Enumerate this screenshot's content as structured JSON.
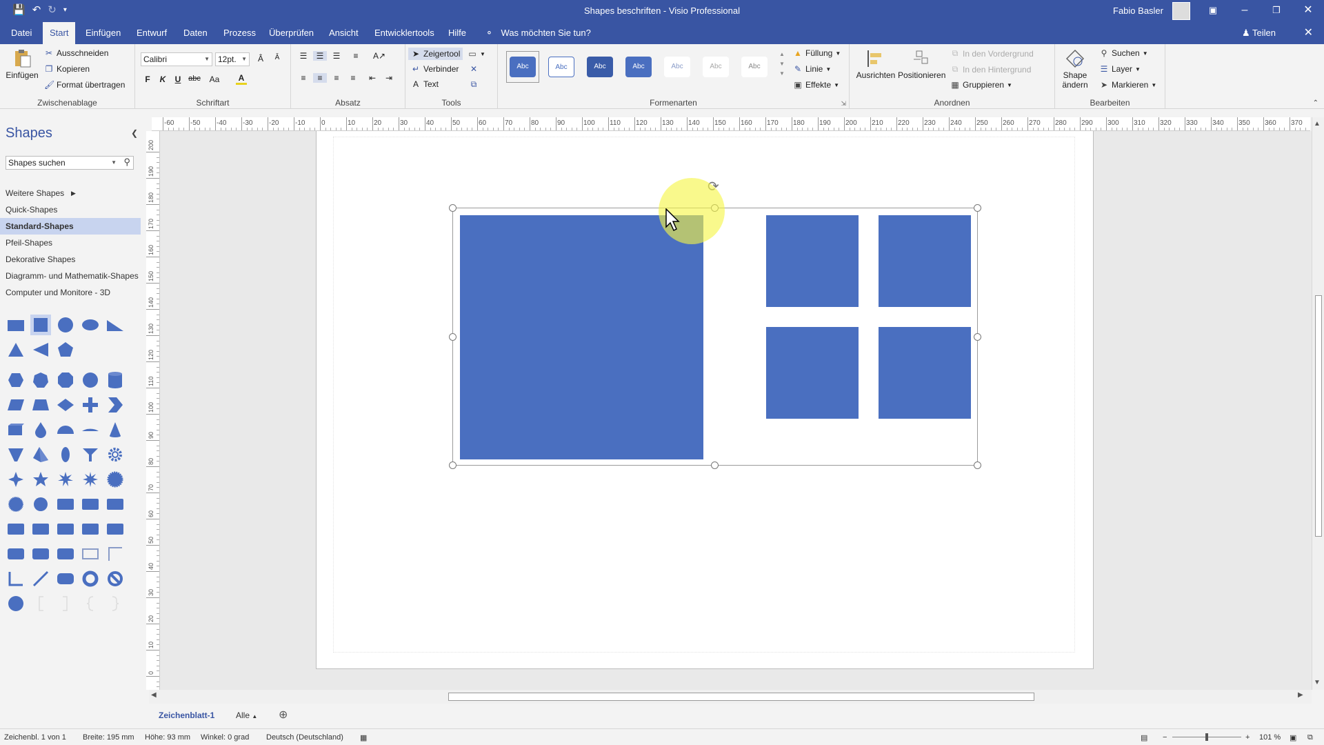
{
  "titlebar": {
    "title": "Shapes beschriften - Visio Professional",
    "user": "Fabio Basler",
    "icons": [
      "save-icon",
      "undo-icon",
      "redo-icon",
      "customize-qat-icon"
    ]
  },
  "tabs": {
    "items": [
      "Datei",
      "Start",
      "Einfügen",
      "Entwurf",
      "Daten",
      "Prozess",
      "Überprüfen",
      "Ansicht",
      "Entwicklertools",
      "Hilfe"
    ],
    "active": "Start",
    "tell_me": "Was möchten Sie tun?",
    "share": "Teilen"
  },
  "ribbon": {
    "clipboard": {
      "label": "Zwischenablage",
      "paste": "Einfügen",
      "cut": "Ausschneiden",
      "copy": "Kopieren",
      "format_painter": "Format übertragen"
    },
    "font": {
      "label": "Schriftart",
      "font_name": "Calibri",
      "font_size": "12pt.",
      "bold": "F",
      "italic": "K",
      "underline": "U",
      "strike": "abc",
      "case": "Aa"
    },
    "paragraph": {
      "label": "Absatz"
    },
    "tools": {
      "label": "Tools",
      "pointer": "Zeigertool",
      "connector": "Verbinder",
      "text": "Text"
    },
    "shape_styles": {
      "label": "Formenarten",
      "sample": "Abc",
      "fill": "Füllung",
      "line": "Linie",
      "effects": "Effekte"
    },
    "arrange": {
      "label": "Anordnen",
      "align": "Ausrichten",
      "position": "Positionieren",
      "bring_front": "In den Vordergrund",
      "send_back": "In den Hintergrund",
      "group": "Gruppieren"
    },
    "editing": {
      "label": "Bearbeiten",
      "change_shape_1": "Shape",
      "change_shape_2": "ändern",
      "find": "Suchen",
      "layer": "Layer",
      "select": "Markieren"
    }
  },
  "shapes_panel": {
    "title": "Shapes",
    "search_placeholder": "Shapes suchen",
    "more_shapes": "Weitere Shapes",
    "stencils": [
      "Quick-Shapes",
      "Standard-Shapes",
      "Pfeil-Shapes",
      "Dekorative Shapes",
      "Diagramm- und Mathematik-Shapes",
      "Computer und Monitore - 3D"
    ],
    "active_stencil": "Standard-Shapes"
  },
  "rulers": {
    "horizontal": [
      "-60",
      "-50",
      "-40",
      "-30",
      "-20",
      "-10",
      "0",
      "10",
      "20",
      "30",
      "40",
      "50",
      "60",
      "70",
      "80",
      "90",
      "100",
      "110",
      "120",
      "130",
      "140",
      "150",
      "160",
      "170",
      "180",
      "190",
      "200",
      "210",
      "220",
      "230",
      "240",
      "250",
      "260",
      "270",
      "280",
      "290",
      "300",
      "310",
      "320",
      "330",
      "340",
      "350",
      "360",
      "370"
    ],
    "vertical": [
      "200",
      "190",
      "180",
      "170",
      "160",
      "150",
      "140",
      "130",
      "120",
      "110",
      "100",
      "90",
      "80",
      "70",
      "60",
      "50",
      "40",
      "30",
      "20",
      "10",
      "0"
    ]
  },
  "sheet": {
    "name": "Zeichenblatt-1",
    "all": "Alle"
  },
  "status": {
    "page": "Zeichenbl. 1 von 1",
    "width": "Breite: 195 mm",
    "height": "Höhe: 93 mm",
    "angle": "Winkel: 0 grad",
    "language": "Deutsch (Deutschland)",
    "zoom": "101 %"
  },
  "colors": {
    "accent": "#3955a3",
    "shape_fill": "#4a6fc0",
    "highlight": "#f5f546"
  }
}
